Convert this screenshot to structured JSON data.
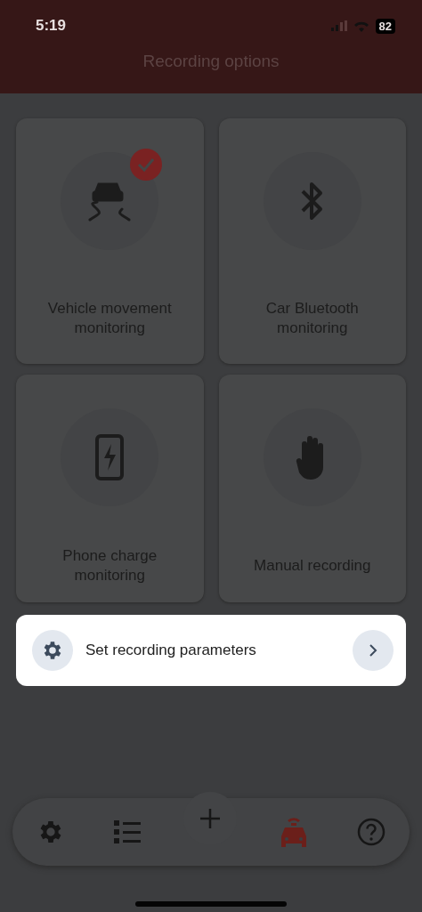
{
  "status_bar": {
    "time": "5:19",
    "battery": "82"
  },
  "header": {
    "title": "Recording options"
  },
  "options": [
    {
      "label": "Vehicle movement monitoring",
      "checked": true
    },
    {
      "label": "Car Bluetooth monitoring",
      "checked": false
    },
    {
      "label": "Phone charge monitoring",
      "checked": false
    },
    {
      "label": "Manual recording",
      "checked": false
    }
  ],
  "parameters_card": {
    "label": "Set recording parameters"
  },
  "nav": [
    {
      "selected": false
    },
    {
      "selected": false
    },
    {
      "selected": false
    },
    {
      "selected": true
    },
    {
      "selected": false
    }
  ]
}
